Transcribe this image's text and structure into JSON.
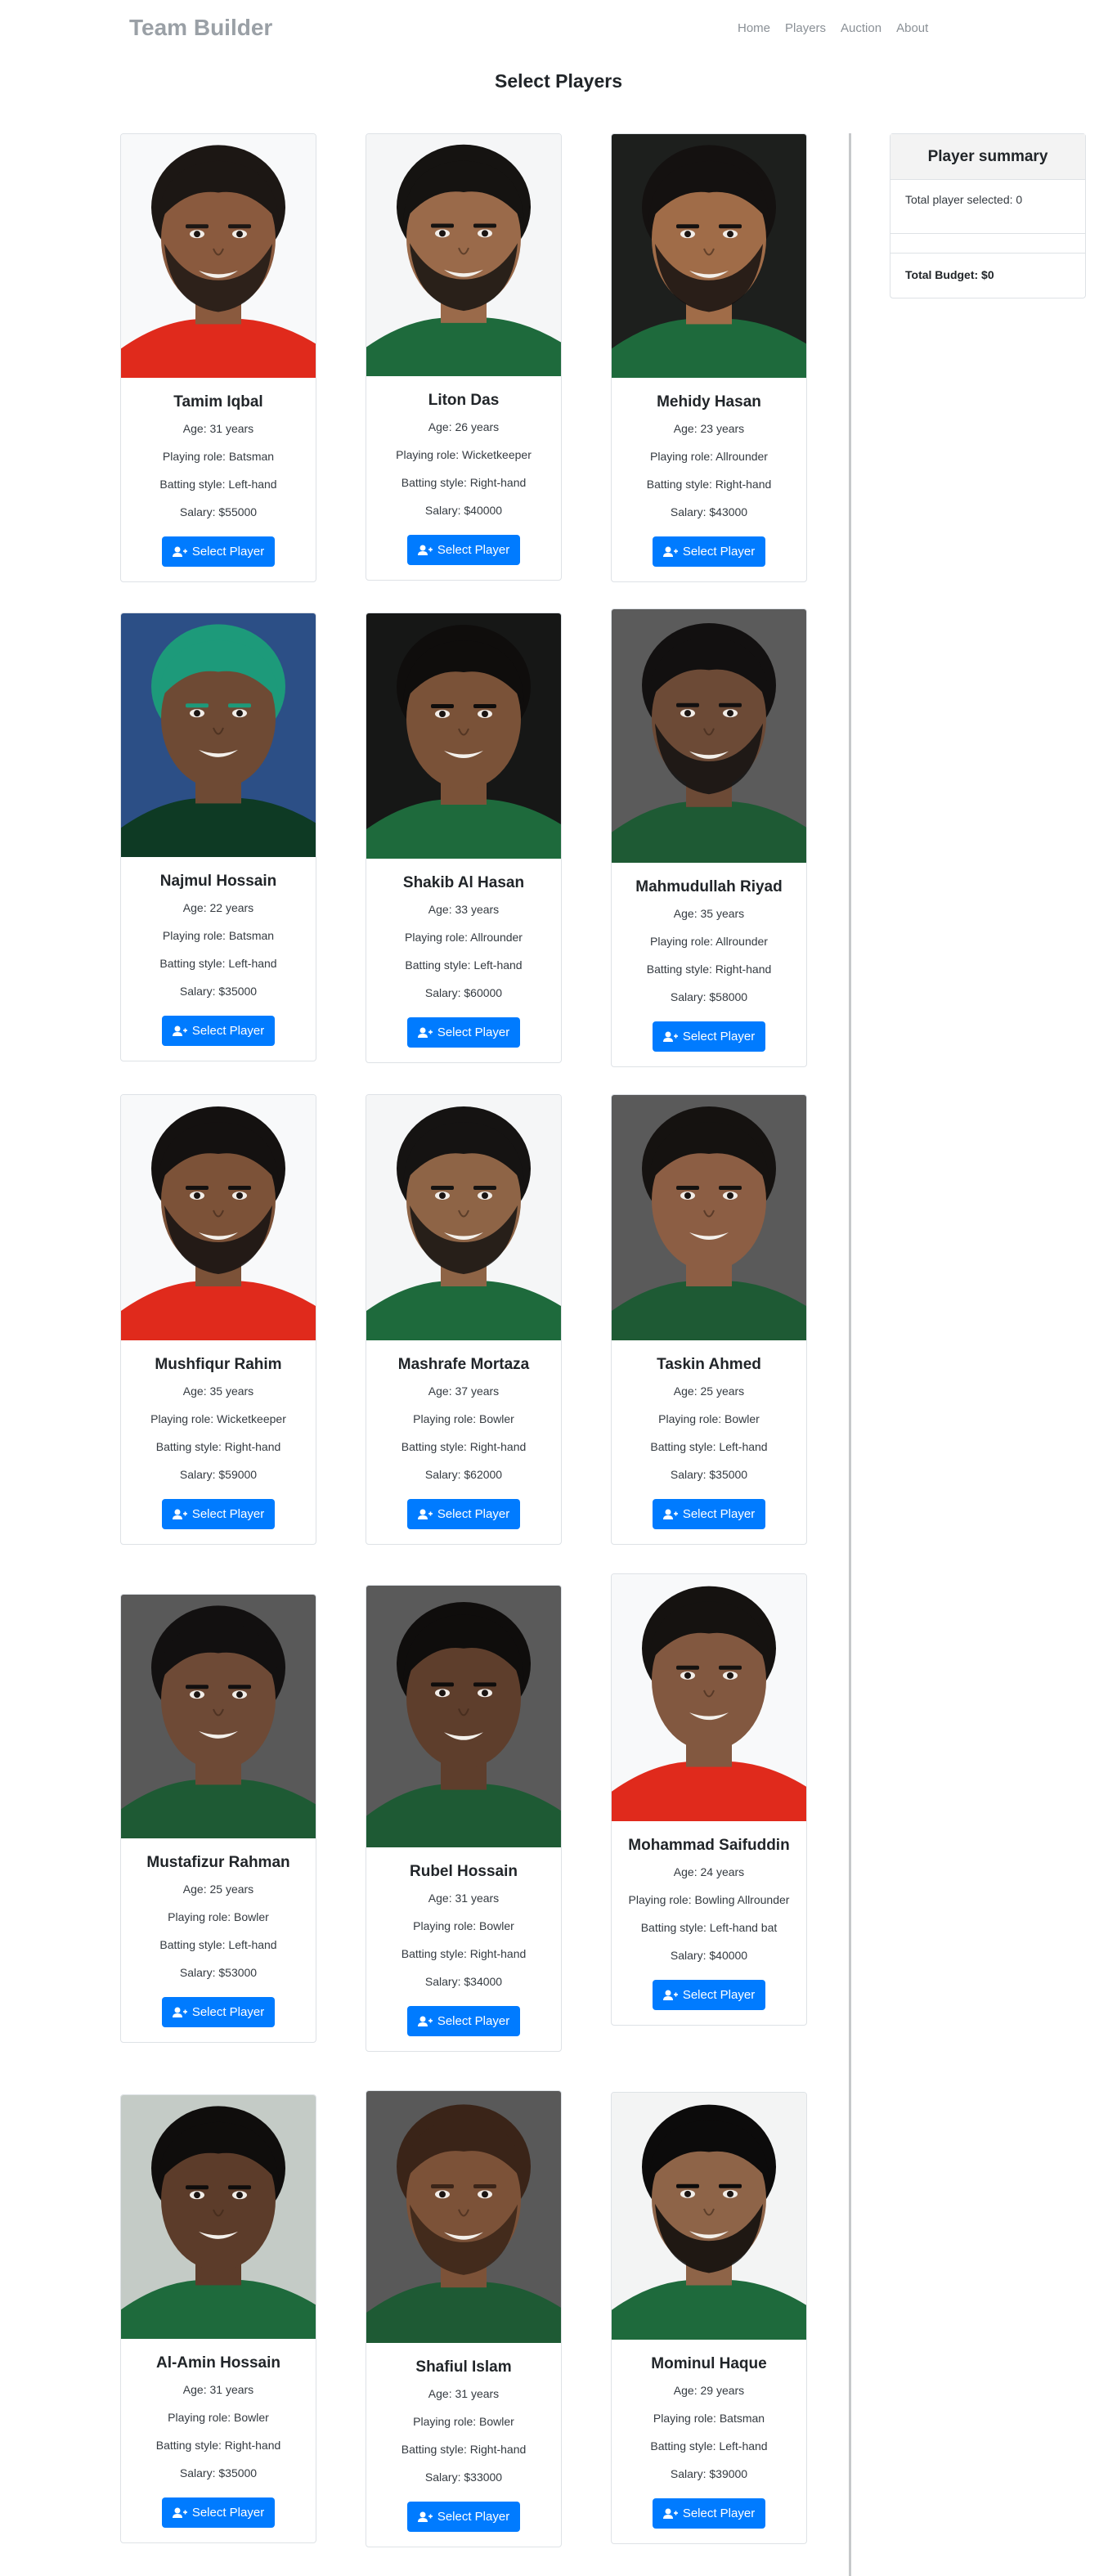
{
  "nav": {
    "brand": "Team Builder",
    "links": [
      "Home",
      "Players",
      "Auction",
      "About"
    ]
  },
  "page_title": "Select Players",
  "select_label": "Select Player",
  "summary": {
    "title": "Player summary",
    "count_text": "Total player selected: 0",
    "budget_text": "Total Budget: $0"
  },
  "players": [
    {
      "name": "Tamim Iqbal",
      "age": "Age: 31 years",
      "role": "Playing role: Batsman",
      "batting": "Batting style: Left-hand",
      "salary": "Salary: $55000",
      "photo": {
        "bg": "#f8f9fa",
        "skin": "#8a5a3e",
        "hair": "#1c1714",
        "jersey": "#e02a1c",
        "beard": true
      }
    },
    {
      "name": "Liton Das",
      "age": "Age: 26 years",
      "role": "Playing role: Wicketkeeper",
      "batting": "Batting style: Right-hand",
      "salary": "Salary: $40000",
      "photo": {
        "bg": "#f5f6f7",
        "skin": "#9a6a4a",
        "hair": "#151311",
        "jersey": "#1e6a3c",
        "beard": true
      }
    },
    {
      "name": "Mehidy Hasan",
      "age": "Age: 23 years",
      "role": "Playing role: Allrounder",
      "batting": "Batting style: Right-hand",
      "salary": "Salary: $43000",
      "photo": {
        "bg": "#1d1f1d",
        "skin": "#a06c48",
        "hair": "#141110",
        "jersey": "#1e6a3c",
        "beard": true
      }
    },
    {
      "name": "Najmul Hossain",
      "age": "Age: 22 years",
      "role": "Playing role: Batsman",
      "batting": "Batting style: Left-hand",
      "salary": "Salary: $35000",
      "photo": {
        "bg": "#2c4f86",
        "skin": "#6e4a34",
        "hair": "#1d9a7a",
        "jersey": "#0e3a24",
        "beard": false
      }
    },
    {
      "name": "Shakib Al Hasan",
      "age": "Age: 33 years",
      "role": "Playing role: Allrounder",
      "batting": "Batting style: Left-hand",
      "salary": "Salary: $60000",
      "photo": {
        "bg": "#161716",
        "skin": "#7a5238",
        "hair": "#0f0d0c",
        "jersey": "#1e6a3c",
        "beard": false
      }
    },
    {
      "name": "Mahmudullah Riyad",
      "age": "Age: 35 years",
      "role": "Playing role: Allrounder",
      "batting": "Batting style: Right-hand",
      "salary": "Salary: $58000",
      "photo": {
        "bg": "#5b5b5b",
        "skin": "#6c4a36",
        "hair": "#121010",
        "jersey": "#1e5a34",
        "beard": true
      }
    },
    {
      "name": "Mushfiqur Rahim",
      "age": "Age: 35 years",
      "role": "Playing role: Wicketkeeper",
      "batting": "Batting style: Right-hand",
      "salary": "Salary: $59000",
      "photo": {
        "bg": "#f8f9fa",
        "skin": "#7c5238",
        "hair": "#141110",
        "jersey": "#e02a1c",
        "beard": true
      }
    },
    {
      "name": "Mashrafe Mortaza",
      "age": "Age: 37 years",
      "role": "Playing role: Bowler",
      "batting": "Batting style: Right-hand",
      "salary": "Salary: $62000",
      "photo": {
        "bg": "#f5f6f7",
        "skin": "#8e6446",
        "hair": "#151312",
        "jersey": "#1e6a3c",
        "beard": true
      }
    },
    {
      "name": "Taskin Ahmed",
      "age": "Age: 25 years",
      "role": "Playing role: Bowler",
      "batting": "Batting style: Left-hand",
      "salary": "Salary: $35000",
      "photo": {
        "bg": "#5a5a5a",
        "skin": "#8c5e44",
        "hair": "#151210",
        "jersey": "#1e5a34",
        "beard": false
      }
    },
    {
      "name": "Mustafizur Rahman",
      "age": "Age: 25 years",
      "role": "Playing role: Bowler",
      "batting": "Batting style: Left-hand",
      "salary": "Salary: $53000",
      "photo": {
        "bg": "#595959",
        "skin": "#6e4a36",
        "hair": "#121010",
        "jersey": "#1e5a34",
        "beard": false
      }
    },
    {
      "name": "Rubel Hossain",
      "age": "Age: 31 years",
      "role": "Playing role: Bowler",
      "batting": "Batting style: Right-hand",
      "salary": "Salary: $34000",
      "photo": {
        "bg": "#5a5a5a",
        "skin": "#5e3e2c",
        "hair": "#0f0d0c",
        "jersey": "#1e5a34",
        "beard": false
      }
    },
    {
      "name": "Mohammad Saifuddin",
      "age": "Age: 24 years",
      "role": "Playing role: Bowling Allrounder",
      "batting": "Batting style: Left-hand bat",
      "salary": "Salary: $40000",
      "photo": {
        "bg": "#f8f9fa",
        "skin": "#825840",
        "hair": "#151210",
        "jersey": "#e02a1c",
        "beard": false
      }
    },
    {
      "name": "Al-Amin Hossain",
      "age": "Age: 31 years",
      "role": "Playing role: Bowler",
      "batting": "Batting style: Right-hand",
      "salary": "Salary: $35000",
      "photo": {
        "bg": "#c4cbc6",
        "skin": "#5c3c2a",
        "hair": "#0f0d0c",
        "jersey": "#1e6a3c",
        "beard": false
      }
    },
    {
      "name": "Shafiul Islam",
      "age": "Age: 31 years",
      "role": "Playing role: Bowler",
      "batting": "Batting style: Right-hand",
      "salary": "Salary: $33000",
      "photo": {
        "bg": "#595959",
        "skin": "#7c5238",
        "hair": "#3a2418",
        "jersey": "#1e5a34",
        "beard": true
      }
    },
    {
      "name": "Mominul Haque",
      "age": "Age: 29 years",
      "role": "Playing role: Batsman",
      "batting": "Batting style: Left-hand",
      "salary": "Salary: $39000",
      "photo": {
        "bg": "#f3f4f4",
        "skin": "#8e6448",
        "hair": "#0c0b0b",
        "jersey": "#1e6a3c",
        "beard": true
      }
    }
  ]
}
